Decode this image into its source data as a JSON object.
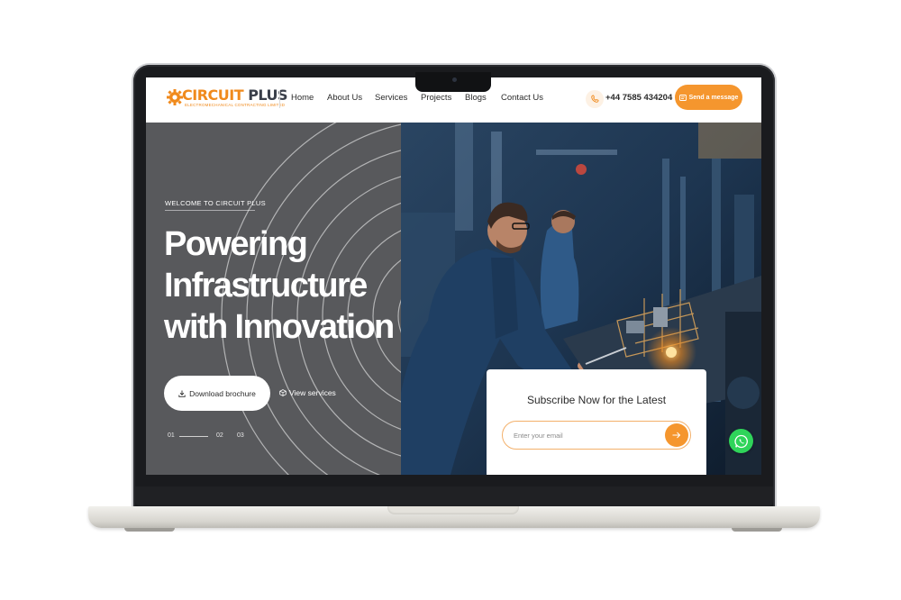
{
  "brand": {
    "name_part1": "CIRCUIT",
    "name_part2": "PLUS",
    "tagline": "ELECTROMECHANICAL CONTRACTING LIMITED",
    "logo_icon": "gear-icon",
    "accent_color": "#f5962e"
  },
  "nav": {
    "links": [
      {
        "label": "Home"
      },
      {
        "label": "About Us"
      },
      {
        "label": "Services"
      },
      {
        "label": "Projects"
      },
      {
        "label": "Blogs"
      },
      {
        "label": "Contact Us"
      }
    ],
    "phone_icon": "phone-icon",
    "phone": "+44 7585 434204",
    "cta_icon": "message-icon",
    "cta_label": "Send a message"
  },
  "hero": {
    "eyebrow": "WELCOME TO CIRCUIT PLUS",
    "headline": [
      "Powering",
      "Infrastructure",
      "with Innovation"
    ],
    "primary_button": "Download brochure",
    "primary_icon": "download-icon",
    "secondary_button": "View services",
    "secondary_icon": "box-icon",
    "slides": [
      "01",
      "02",
      "03"
    ],
    "active_slide": 1
  },
  "subscribe": {
    "title": "Subscribe Now for the Latest",
    "email_placeholder": "Enter your email",
    "submit_icon": "arrow-right-icon"
  },
  "floating": {
    "whatsapp_icon": "whatsapp-icon"
  }
}
